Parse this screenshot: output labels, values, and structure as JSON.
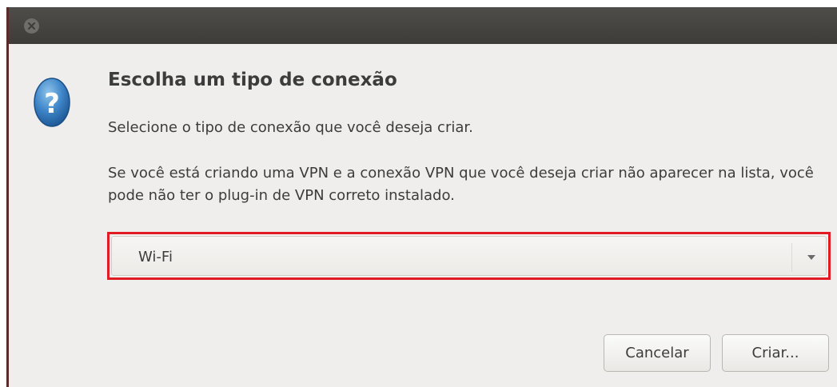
{
  "dialog": {
    "title": "Escolha um tipo de conexão",
    "subtitle": "Selecione o tipo de conexão que você deseja criar.",
    "info": "Se você está criando uma VPN e a conexão VPN que você deseja criar não aparecer na lista, você pode não ter o plug-in de VPN correto instalado.",
    "icon": "question-icon"
  },
  "connection_type": {
    "selected": "Wi-Fi",
    "highlight_color": "#e01b24"
  },
  "buttons": {
    "cancel_label": "Cancelar",
    "create_label": "Criar..."
  },
  "titlebar": {
    "close_icon": "close-icon"
  }
}
